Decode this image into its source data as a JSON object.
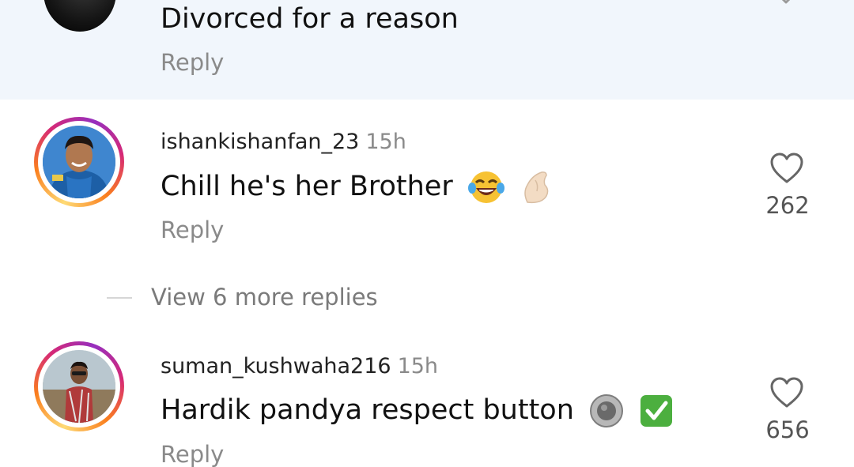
{
  "highlighted_comment": {
    "text": "Divorced for a reason",
    "reply_label": "Reply"
  },
  "comments": [
    {
      "username": "ishankishanfan_23",
      "time": "15h",
      "text": "Chill he's her Brother",
      "emojis": [
        "face-with-tears-of-joy-emoji",
        "pinched-fingers-emoji"
      ],
      "reply_label": "Reply",
      "like_count": "262",
      "view_more_label": "View 6 more replies"
    },
    {
      "username": "suman_kushwaha216",
      "time": "15h",
      "text": "Hardik pandya respect button",
      "emojis": [
        "radio-button-emoji",
        "check-mark-button-emoji"
      ],
      "reply_label": "Reply",
      "like_count": "656"
    }
  ],
  "colors": {
    "highlight_bg": "#f1f6fc",
    "muted_text": "#8a8a8a",
    "story_ring": [
      "#feda75",
      "#fa7e1e",
      "#d62976",
      "#962fbf"
    ]
  }
}
